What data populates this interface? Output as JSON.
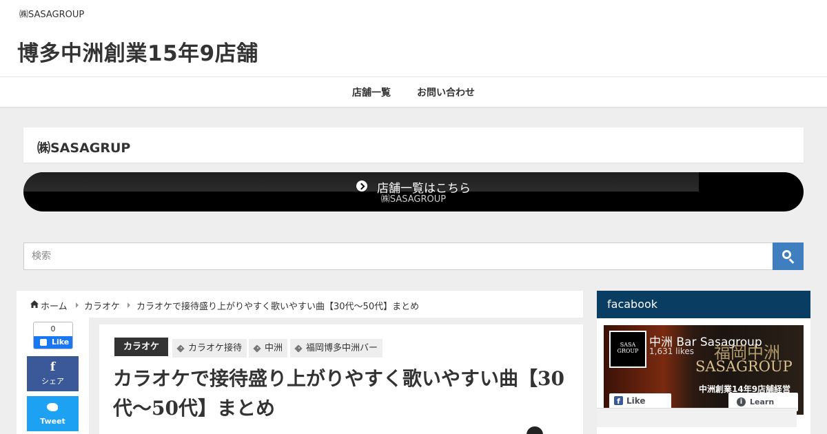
{
  "header": {
    "tagline": "㈱SASAGROUP",
    "site_title": "博多中洲創業15年9店舗"
  },
  "nav": {
    "items": [
      {
        "label": "店舗一覧"
      },
      {
        "label": "お問い合わせ"
      }
    ]
  },
  "notice": {
    "text": "㈱SASAGRUP"
  },
  "banner": {
    "main_text": "店舗一覧はこちら",
    "sub_text": "㈱SASAGROUP",
    "icon": "chevron-circle-right-icon"
  },
  "search": {
    "placeholder": "検索",
    "icon": "search-icon",
    "accent_color": "#3f7fc0"
  },
  "breadcrumb": {
    "items": [
      {
        "label": "ホーム",
        "icon": "home-icon"
      },
      {
        "label": "カラオケ"
      },
      {
        "label": "カラオケで接待盛り上がりやすく歌いやすい曲【30代～50代】まとめ"
      }
    ]
  },
  "share": {
    "facebook_like": {
      "count": "0",
      "label": "Like"
    },
    "facebook_share": {
      "icon": "facebook-icon",
      "label": "シェア",
      "color": "#3b5998"
    },
    "twitter": {
      "icon": "twitter-icon",
      "label": "Tweet",
      "color": "#1da1f2"
    }
  },
  "article": {
    "category": "カラオケ",
    "tags": [
      "カラオケ接待",
      "中洲",
      "福岡博多中洲バー"
    ],
    "title": "カラオケで接待盛り上がりやすく歌いやすい曲【30代～50代】まとめ"
  },
  "sidebar": {
    "widget_title": "facabook",
    "header_color": "#0a3d62",
    "fb_page": {
      "logo_text": "SASA GROUP",
      "name": "中洲 Bar Sasagroup",
      "likes": "1,631 likes",
      "promo_line1": "福岡中洲",
      "promo_line2": "SASAGROUP",
      "promo_line3": "中洲創業14年9店舗経営",
      "like_button": "Like Page",
      "learn_button": "Learn More"
    }
  }
}
